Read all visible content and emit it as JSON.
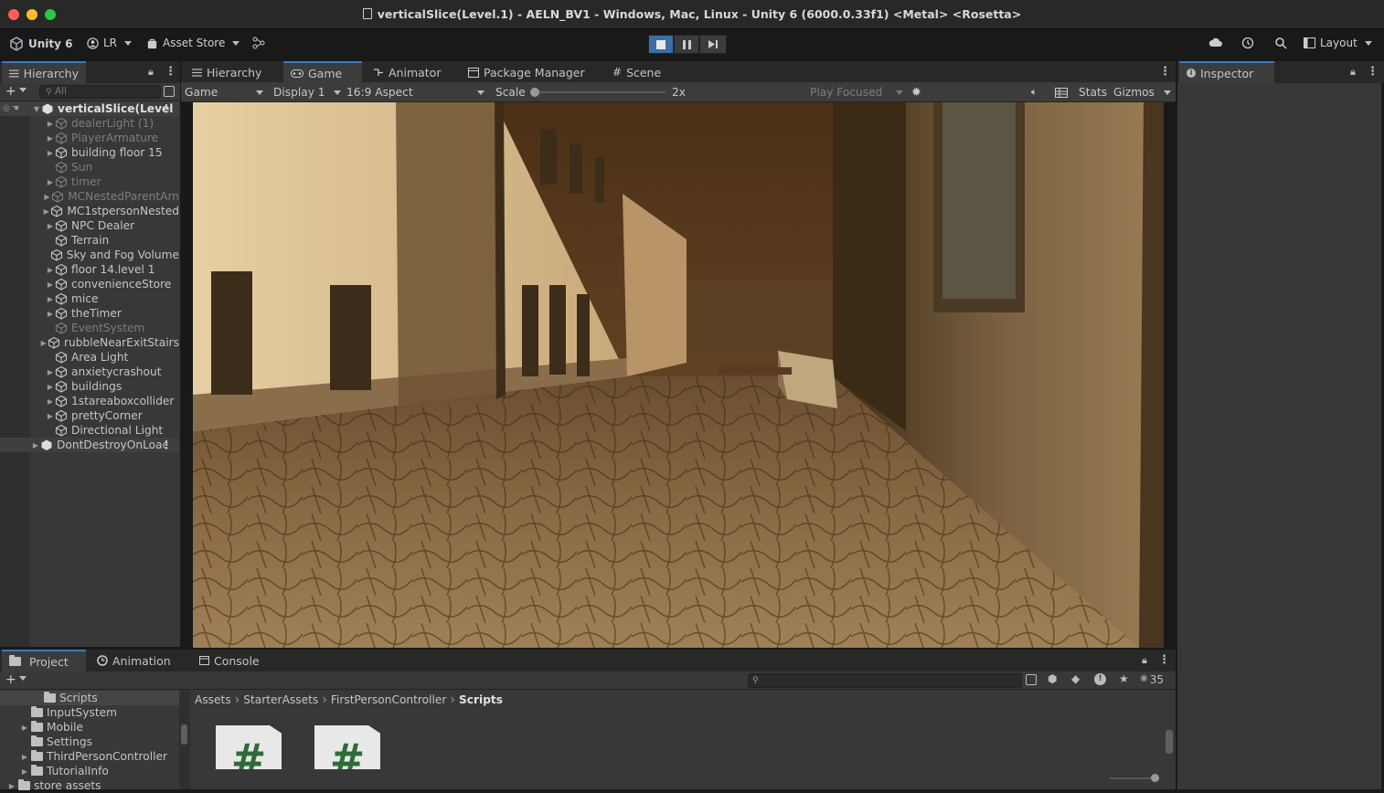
{
  "window": {
    "title": "verticalSlice(Level.1) - AELN_BV1 - Windows, Mac, Linux - Unity 6 (6000.0.33f1) <Metal> <Rosetta>"
  },
  "toolbar": {
    "unity_label": "Unity 6",
    "account_label": "LR",
    "asset_store_label": "Asset Store",
    "layout_label": "Layout"
  },
  "hierarchy": {
    "tab_label": "Hierarchy",
    "search_placeholder": "All",
    "scene_name": "verticalSlice(Level",
    "items": [
      {
        "label": "dealerLight (1)",
        "dim": true,
        "arrow": true
      },
      {
        "label": "PlayerArmature",
        "dim": true,
        "arrow": true
      },
      {
        "label": "building floor 15",
        "dim": false,
        "arrow": true
      },
      {
        "label": "Sun",
        "dim": true,
        "arrow": false
      },
      {
        "label": "timer",
        "dim": true,
        "arrow": true
      },
      {
        "label": "MCNestedParentArn",
        "dim": true,
        "arrow": true
      },
      {
        "label": "MC1stpersonNested",
        "dim": false,
        "arrow": true
      },
      {
        "label": "NPC Dealer",
        "dim": false,
        "arrow": true
      },
      {
        "label": "Terrain",
        "dim": false,
        "arrow": false
      },
      {
        "label": "Sky and Fog Volume",
        "dim": false,
        "arrow": false
      },
      {
        "label": "floor 14.level 1",
        "dim": false,
        "arrow": true
      },
      {
        "label": "convenienceStore",
        "dim": false,
        "arrow": true
      },
      {
        "label": "mice",
        "dim": false,
        "arrow": true
      },
      {
        "label": "theTimer",
        "dim": false,
        "arrow": true
      },
      {
        "label": "EventSystem",
        "dim": true,
        "arrow": false
      },
      {
        "label": "rubbleNearExitStairs",
        "dim": false,
        "arrow": true
      },
      {
        "label": "Area Light",
        "dim": false,
        "arrow": false
      },
      {
        "label": "anxietycrashout",
        "dim": false,
        "arrow": true
      },
      {
        "label": "buildings",
        "dim": false,
        "arrow": true
      },
      {
        "label": "1stareaboxcollider",
        "dim": false,
        "arrow": true
      },
      {
        "label": "prettyCorner",
        "dim": false,
        "arrow": true
      },
      {
        "label": "Directional Light",
        "dim": false,
        "arrow": false
      }
    ],
    "dontdestroy": "DontDestroyOnLoac"
  },
  "center_tabs": {
    "hierarchy": "Hierarchy",
    "game": "Game",
    "animator": "Animator",
    "package_manager": "Package Manager",
    "scene": "Scene"
  },
  "game_controls": {
    "mode": "Game",
    "display": "Display 1",
    "aspect": "16:9 Aspect",
    "scale_label": "Scale",
    "scale_value": "2x",
    "play_mode": "Play Focused",
    "stats": "Stats",
    "gizmos": "Gizmos"
  },
  "inspector": {
    "tab_label": "Inspector"
  },
  "bottom_tabs": {
    "project": "Project",
    "animation": "Animation",
    "console": "Console"
  },
  "project": {
    "tree": [
      {
        "label": "Scripts",
        "indent": 2,
        "arrow": false,
        "selected": true
      },
      {
        "label": "InputSystem",
        "indent": 1,
        "arrow": false
      },
      {
        "label": "Mobile",
        "indent": 1,
        "arrow": true
      },
      {
        "label": "Settings",
        "indent": 1,
        "arrow": false
      },
      {
        "label": "ThirdPersonController",
        "indent": 1,
        "arrow": true
      },
      {
        "label": "TutorialInfo",
        "indent": 1,
        "arrow": true
      },
      {
        "label": "store assets",
        "indent": 0,
        "arrow": true
      }
    ],
    "breadcrumb": [
      "Assets",
      "StarterAssets",
      "FirstPersonController",
      "Scripts"
    ],
    "hidden_count": "35",
    "script_glyph": "#"
  }
}
